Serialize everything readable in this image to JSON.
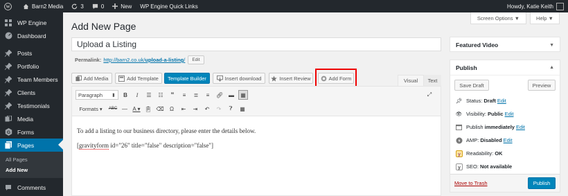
{
  "adminbar": {
    "site_name": "Barn2 Media",
    "updates_count": "3",
    "comments_count": "0",
    "new_label": "New",
    "quick_links": "WP Engine Quick Links",
    "howdy": "Howdy, Katie Keith"
  },
  "sidebar": {
    "items": [
      {
        "label": "WP Engine",
        "icon": "wp-engine-icon"
      },
      {
        "label": "Dashboard",
        "icon": "dashboard-icon"
      },
      {
        "label": "Posts",
        "icon": "pin-icon"
      },
      {
        "label": "Portfolio",
        "icon": "pin-icon"
      },
      {
        "label": "Team Members",
        "icon": "pin-icon"
      },
      {
        "label": "Clients",
        "icon": "pin-icon"
      },
      {
        "label": "Testimonials",
        "icon": "pin-icon"
      },
      {
        "label": "Media",
        "icon": "media-icon"
      },
      {
        "label": "Forms",
        "icon": "forms-icon"
      },
      {
        "label": "Pages",
        "icon": "pages-icon"
      },
      {
        "label": "Comments",
        "icon": "comments-icon"
      }
    ],
    "submenu": [
      "All Pages",
      "Add New"
    ]
  },
  "screen_options": "Screen Options ▼",
  "help": "Help ▼",
  "page_title": "Add New Page",
  "post_title": "Upload a Listing",
  "permalink": {
    "label": "Permalink:",
    "url_prefix": "http://barn2.co.uk/",
    "slug": "upload-a-listing",
    "url_suffix": "/",
    "edit": "Edit"
  },
  "media_buttons": {
    "add_media": "Add Media",
    "add_template": "Add Template",
    "template_builder": "Template Builder",
    "insert_download": "Insert download",
    "insert_review": "Insert Review",
    "add_form": "Add Form"
  },
  "editor_tabs": {
    "visual": "Visual",
    "text": "Text"
  },
  "toolbar": {
    "paragraph": "Paragraph",
    "formats": "Formats"
  },
  "content": {
    "line1": "To add a listing to our business directory, please enter the details below.",
    "shortcode_open": "[",
    "shortcode_name": "gravityform",
    "shortcode_rest": " id=\"26\" title=\"false\" description=\"false\"]"
  },
  "featured_video": {
    "title": "Featured Video"
  },
  "publish_box": {
    "title": "Publish",
    "save_draft": "Save Draft",
    "preview": "Preview",
    "status_label": "Status:",
    "status_value": "Draft",
    "visibility_label": "Visibility:",
    "visibility_value": "Public",
    "publish_label": "Publish",
    "publish_value": "immediately",
    "amp_label": "AMP:",
    "amp_value": "Disabled",
    "readability_label": "Readability:",
    "readability_value": "OK",
    "seo_label": "SEO:",
    "seo_value": "Not available",
    "edit": "Edit",
    "trash": "Move to Trash",
    "publish_button": "Publish"
  },
  "colors": {
    "admin_dark": "#23282d",
    "accent_blue": "#0073aa",
    "primary_button": "#0085ba",
    "highlight_red": "#ee0000"
  }
}
